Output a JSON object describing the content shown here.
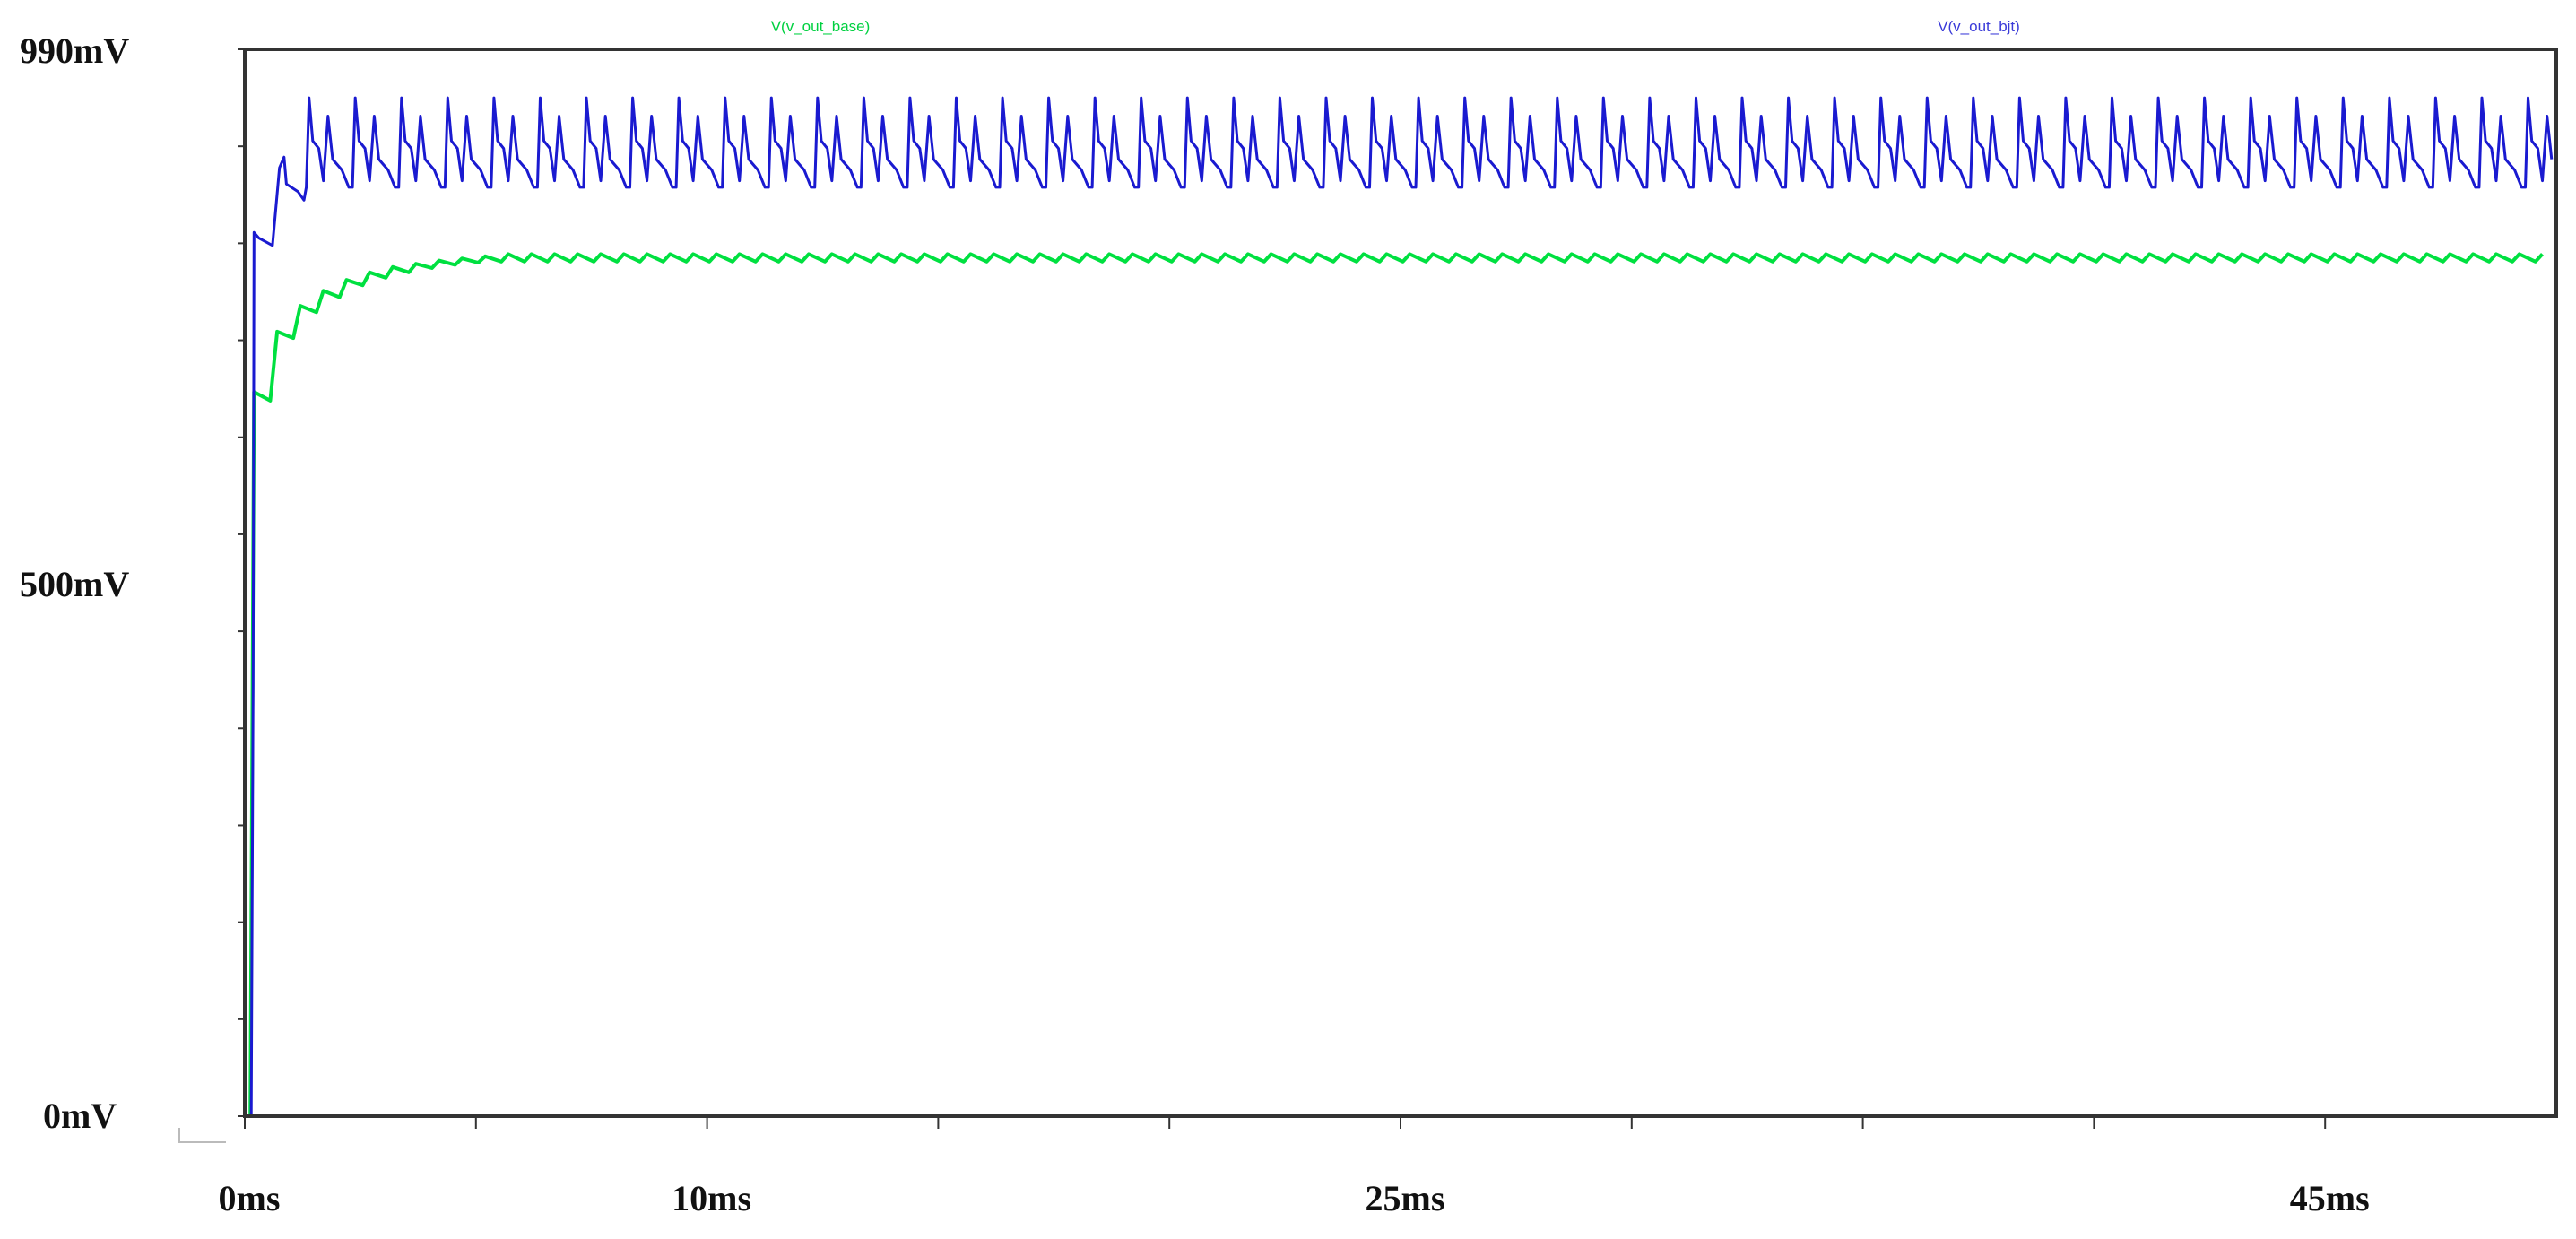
{
  "chart_data": {
    "type": "line",
    "title": "",
    "xlabel": "",
    "ylabel": "",
    "xlim": [
      0,
      50
    ],
    "ylim": [
      0,
      990
    ],
    "x_unit": "ms",
    "y_unit": "mV",
    "x_tick_step": 5,
    "y_tick_step": 90,
    "x_tick_labels": [
      {
        "value": 0,
        "label": "0ms"
      },
      {
        "value": 10,
        "label": "10ms"
      },
      {
        "value": 25,
        "label": "25ms"
      },
      {
        "value": 45,
        "label": "45ms"
      }
    ],
    "y_tick_labels": [
      {
        "value": 990,
        "label": "990mV"
      },
      {
        "value": 500,
        "label": "500mV"
      },
      {
        "value": 0,
        "label": "0mV"
      }
    ],
    "grid": false,
    "legend_placement": "top",
    "series": [
      {
        "name": "V(v_out_base)",
        "color": "#00e040",
        "transient": [
          [
            0,
            0
          ],
          [
            0.12,
            0
          ],
          [
            0.2,
            672
          ],
          [
            0.55,
            664
          ],
          [
            0.7,
            728
          ],
          [
            1.05,
            722
          ],
          [
            1.2,
            752
          ],
          [
            1.55,
            746
          ],
          [
            1.7,
            766
          ],
          [
            2.05,
            760
          ],
          [
            2.2,
            776
          ],
          [
            2.55,
            771
          ],
          [
            2.7,
            783
          ],
          [
            3.05,
            778
          ],
          [
            3.2,
            788
          ],
          [
            3.55,
            783
          ],
          [
            3.7,
            791
          ],
          [
            4.05,
            787
          ],
          [
            4.2,
            794
          ],
          [
            4.55,
            790
          ],
          [
            4.7,
            796
          ],
          [
            5.05,
            792
          ],
          [
            5.2,
            798
          ],
          [
            5.55,
            793
          ]
        ],
        "steady_start": 5.7,
        "period": 0.5,
        "period_template": [
          [
            0,
            800
          ],
          [
            0.35,
            793
          ]
        ],
        "steady_range_mV": [
          792,
          800
        ]
      },
      {
        "name": "V(v_out_bjt)",
        "color": "#1a1ad0",
        "transient": [
          [
            0,
            0
          ],
          [
            0.14,
            0
          ],
          [
            0.18,
            400
          ],
          [
            0.2,
            820
          ],
          [
            0.3,
            815
          ],
          [
            0.6,
            808
          ],
          [
            0.75,
            880
          ],
          [
            0.85,
            890
          ],
          [
            0.9,
            865
          ],
          [
            1.15,
            858
          ],
          [
            1.28,
            850
          ]
        ],
        "steady_start": 1.33,
        "period": 1.0,
        "period_template": [
          [
            0,
            862
          ],
          [
            0.06,
            945
          ],
          [
            0.14,
            905
          ],
          [
            0.27,
            898
          ],
          [
            0.37,
            868
          ],
          [
            0.47,
            928
          ],
          [
            0.57,
            888
          ],
          [
            0.77,
            878
          ],
          [
            0.92,
            862
          ]
        ],
        "steady_range_mV": [
          862,
          945
        ]
      }
    ]
  }
}
